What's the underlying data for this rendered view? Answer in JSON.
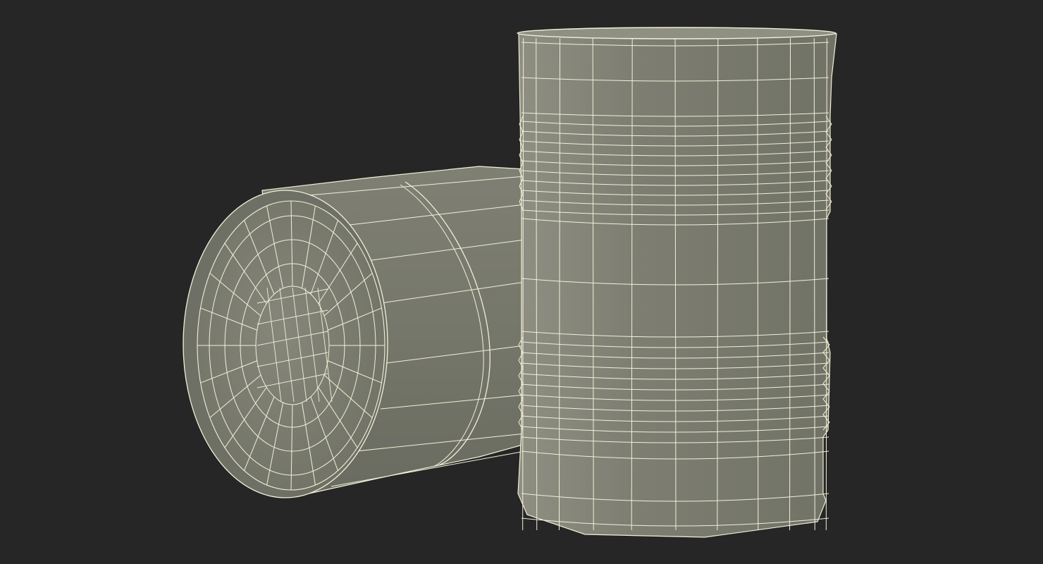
{
  "scene": {
    "subject": "wireframe-render",
    "objects": [
      {
        "name": "barrel-lying",
        "orientation": "horizontal"
      },
      {
        "name": "barrel-standing",
        "orientation": "vertical"
      }
    ]
  },
  "colors": {
    "background": "#262626",
    "surface": "#7b7c6f",
    "surface_light": "#8a8b7e",
    "surface_dark": "#65665b",
    "wire": "#f2f0d8"
  }
}
